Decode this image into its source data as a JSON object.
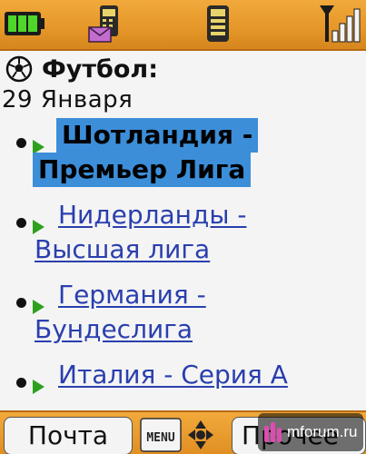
{
  "header": {
    "title": "Футбол:",
    "date": "29 Января"
  },
  "status_icons": [
    "battery-icon",
    "mail-phone-icon",
    "sim-icon",
    "signal-icon"
  ],
  "leagues": [
    {
      "line1": "Шотландия -",
      "line2": "Премьер Лига",
      "selected": true
    },
    {
      "line1": "Нидерланды -",
      "line2": "Высшая лига",
      "selected": false
    },
    {
      "line1": "Германия -",
      "line2": "Бундеслига",
      "selected": false
    },
    {
      "line1": "Италия - Серия А",
      "line2": "",
      "selected": false
    }
  ],
  "softkeys": {
    "left": "Почта",
    "center": "MENU",
    "right": "Прочее"
  },
  "watermark": "mforum.ru",
  "colors": {
    "bar": "#e59628",
    "link": "#2a3fae",
    "highlight": "#3c8ed9",
    "arrow": "#2ea01f"
  }
}
